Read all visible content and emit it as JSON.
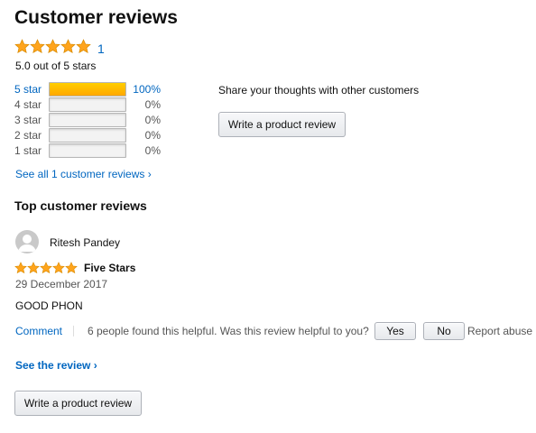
{
  "header": {
    "title": "Customer reviews"
  },
  "summary": {
    "rating_count": "1",
    "average_text": "5.0 out of 5 stars",
    "stars": 5
  },
  "histogram": [
    {
      "label": "5 star",
      "percent_text": "100%",
      "fraction": 1.0,
      "link": true
    },
    {
      "label": "4 star",
      "percent_text": "0%",
      "fraction": 0.0,
      "link": false
    },
    {
      "label": "3 star",
      "percent_text": "0%",
      "fraction": 0.0,
      "link": false
    },
    {
      "label": "2 star",
      "percent_text": "0%",
      "fraction": 0.0,
      "link": false
    },
    {
      "label": "1 star",
      "percent_text": "0%",
      "fraction": 0.0,
      "link": false
    }
  ],
  "see_all": {
    "label": "See all 1 customer reviews ›"
  },
  "share": {
    "text": "Share your thoughts with other customers",
    "button_label": "Write a product review"
  },
  "top_reviews": {
    "title": "Top customer reviews",
    "review": {
      "reviewer": "Ritesh Pandey",
      "stars": 5,
      "title": "Five Stars",
      "date": "29 December 2017",
      "body": "GOOD PHON",
      "comment_label": "Comment",
      "helpful_text": "6 people found this helpful. Was this review helpful to you?",
      "yes_label": "Yes",
      "no_label": "No",
      "report_label": "Report abuse"
    },
    "see_review_label": "See the review ›",
    "write_button_label": "Write a product review"
  },
  "colors": {
    "link": "#0066c0",
    "star": "#ffa41c",
    "bar_fill": "#ffa700"
  },
  "icons": {
    "star": "star-icon",
    "avatar": "user-avatar-icon"
  }
}
